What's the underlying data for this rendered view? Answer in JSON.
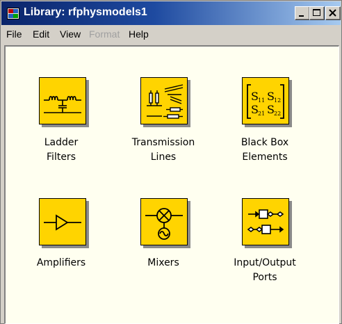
{
  "window": {
    "title": "Library: rfphysmodels1",
    "app_icon": "simulink-library-icon",
    "controls": [
      "minimize-icon",
      "maximize-icon",
      "close-icon"
    ]
  },
  "menu": [
    "File",
    "Edit",
    "View",
    "Format",
    "Help"
  ],
  "menu_disabled": [
    "Format"
  ],
  "blocks": [
    {
      "label_line1": "Ladder",
      "label_line2": "Filters",
      "icon": "ladder-filter-icon"
    },
    {
      "label_line1": "Transmission",
      "label_line2": "Lines",
      "icon": "transmission-lines-icon"
    },
    {
      "label_line1": "Black Box",
      "label_line2": "Elements",
      "icon": "s-parameter-matrix-icon",
      "matrix": [
        "S",
        "11",
        "S",
        "12",
        "S",
        "21",
        "S",
        "22"
      ]
    },
    {
      "label_line1": "Amplifiers",
      "label_line2": "",
      "icon": "amplifier-icon"
    },
    {
      "label_line1": "Mixers",
      "label_line2": "",
      "icon": "mixer-icon"
    },
    {
      "label_line1": "Input/Output",
      "label_line2": "Ports",
      "icon": "input-output-ports-icon"
    }
  ],
  "colors": {
    "block_fill": "#ffd400",
    "canvas": "#fffff0",
    "title_gradient_start": "#0a246a",
    "title_gradient_end": "#a6caf0",
    "chrome": "#d4d0c8"
  }
}
